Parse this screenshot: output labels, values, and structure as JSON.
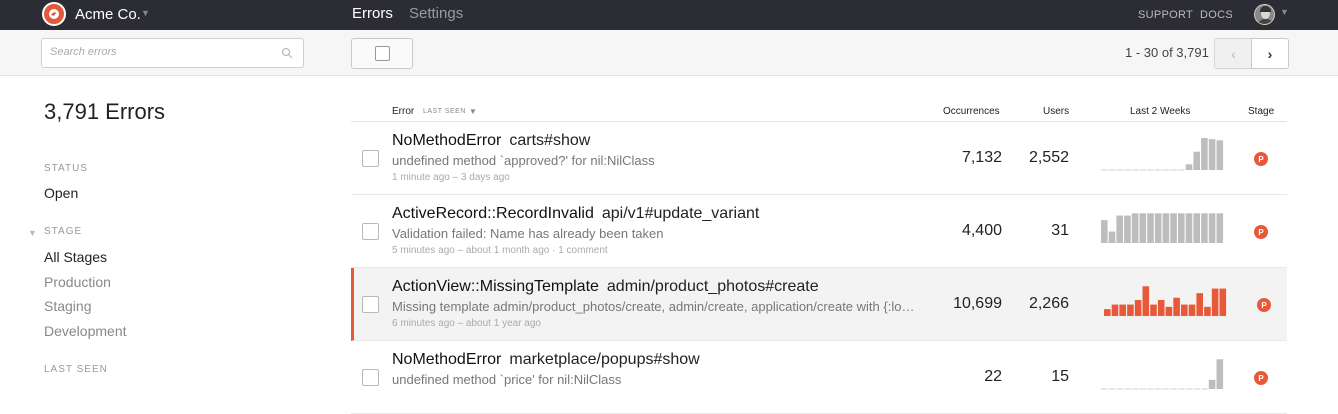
{
  "app": {
    "brand": "Acme Co.",
    "nav": {
      "errors": "Errors",
      "settings": "Settings",
      "support": "SUPPORT",
      "docs": "DOCS"
    }
  },
  "toolbar": {
    "search_placeholder": "Search errors",
    "pager": "1 - 30 of 3,791",
    "prev": "‹",
    "next": "›"
  },
  "sidebar": {
    "count_title": "3,791 Errors",
    "status_heading": "STATUS",
    "status_value": "Open",
    "stage_heading": "STAGE",
    "stages": [
      "All Stages",
      "Production",
      "Staging",
      "Development"
    ],
    "last_seen_heading": "LAST SEEN"
  },
  "table": {
    "headers": {
      "error": "Error",
      "sort": "LAST SEEN",
      "occurrences": "Occurrences",
      "users": "Users",
      "trend": "Last 2 Weeks",
      "stage": "Stage"
    },
    "rows": [
      {
        "error": "NoMethodError",
        "context": "carts#show",
        "message": "undefined method `approved?' for nil:NilClass",
        "meta": "1 minute ago  –  3 days ago",
        "occurrences": "7,132",
        "users": "2,552",
        "stage": "P",
        "trend": [
          0,
          0,
          0,
          0,
          0,
          0,
          0,
          0,
          0,
          0,
          0,
          5,
          16,
          28,
          27,
          26
        ],
        "trend_color": "#bdbdbd"
      },
      {
        "error": "ActiveRecord::RecordInvalid",
        "context": "api/v1#update_variant",
        "message": "Validation failed: Name has already been taken",
        "meta": "5 minutes ago  –  about 1 month ago  ·  1 comment",
        "occurrences": "4,400",
        "users": "31",
        "stage": "P",
        "trend": [
          20,
          10,
          24,
          24,
          26,
          26,
          26,
          26,
          26,
          26,
          26,
          26,
          26,
          26,
          26,
          26
        ],
        "trend_color": "#bdbdbd"
      },
      {
        "error": "ActionView::MissingTemplate",
        "context": "admin/product_photos#create",
        "message": "Missing template admin/product_photos/create, admin/create, application/create with {:locale=>[:en], :formats=>[:json], :handlers=>[:erb]}",
        "meta": "6 minutes ago  –  about 1 year ago",
        "occurrences": "10,699",
        "users": "2,266",
        "stage": "P",
        "trend": [
          6,
          10,
          10,
          10,
          14,
          26,
          10,
          14,
          8,
          16,
          10,
          10,
          20,
          8,
          24,
          24
        ],
        "trend_color": "#e8593a",
        "highlight": true
      },
      {
        "error": "NoMethodError",
        "context": "marketplace/popups#show",
        "message": "undefined method `price' for nil:NilClass",
        "meta": "",
        "occurrences": "22",
        "users": "15",
        "stage": "P",
        "trend": [
          0,
          0,
          0,
          0,
          0,
          0,
          0,
          0,
          0,
          0,
          0,
          0,
          0,
          0,
          8,
          26
        ],
        "trend_color": "#bdbdbd"
      }
    ]
  }
}
